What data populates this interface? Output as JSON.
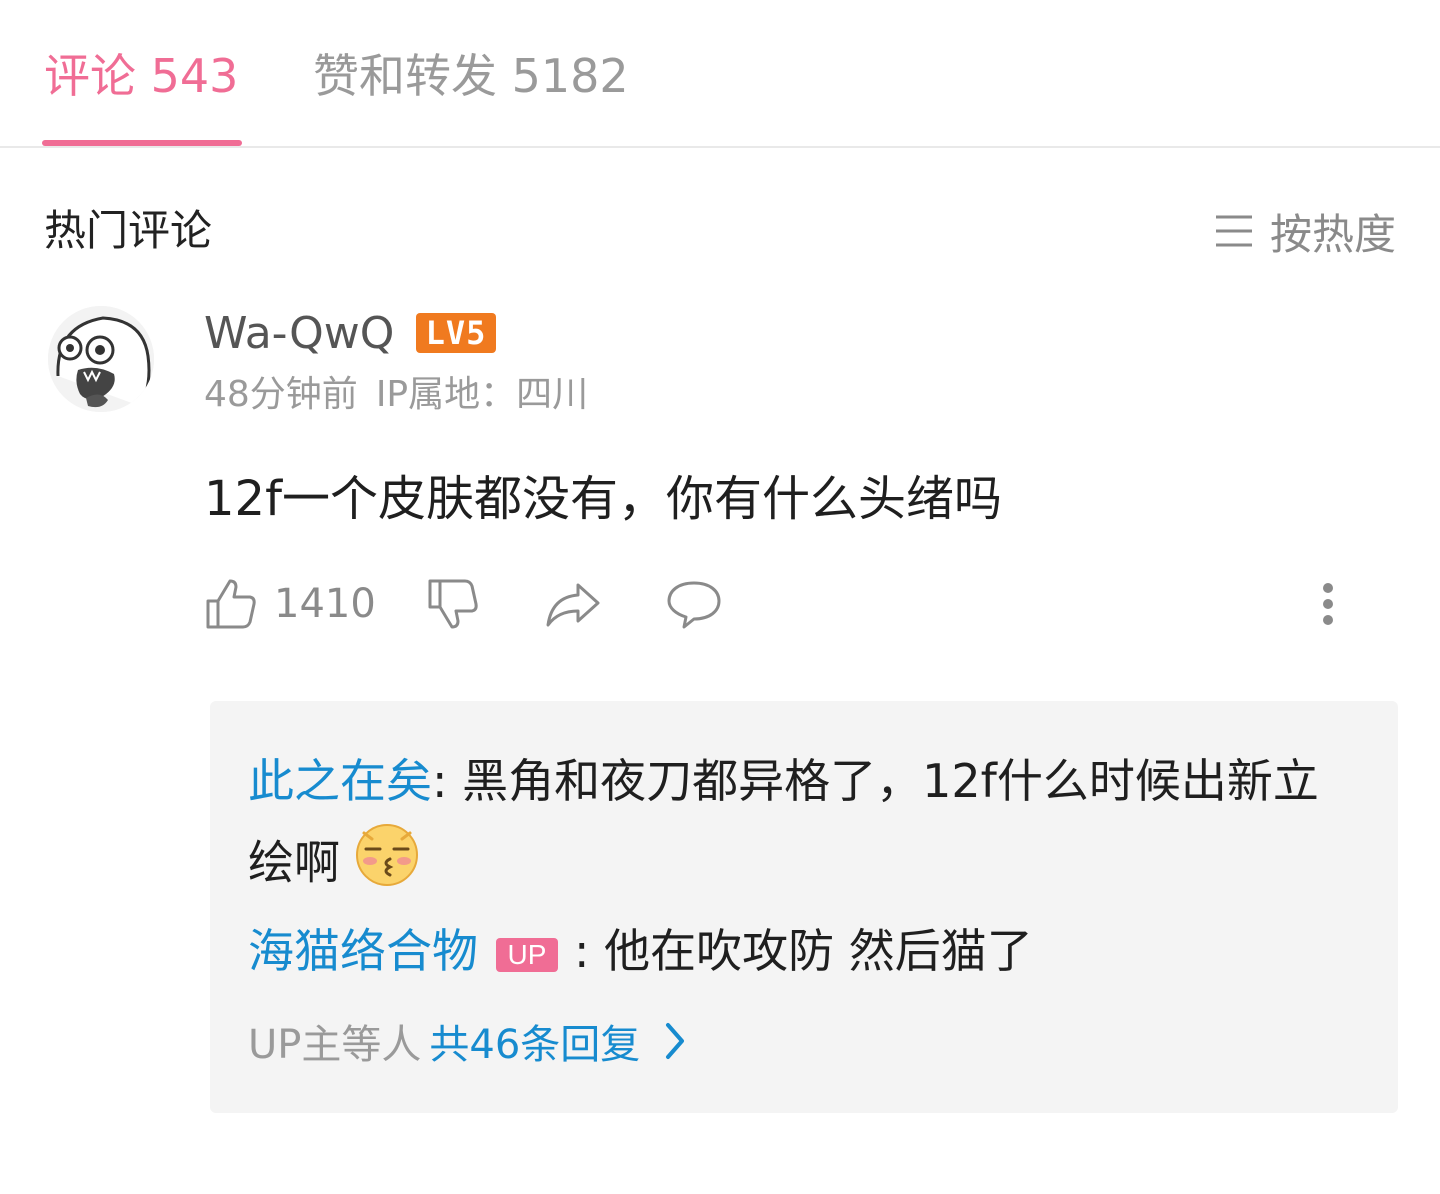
{
  "tabs": {
    "comments_label": "评论 543",
    "likes_label": "赞和转发 5182"
  },
  "section": {
    "title": "热门评论",
    "sort_label": "按热度"
  },
  "comment": {
    "username": "Wa-QwQ",
    "level_badge": "LV5",
    "time": "48分钟前",
    "ip_location": "IP属地：四川",
    "content": "12f一个皮肤都没有，你有什么头绪吗",
    "like_count": "1410"
  },
  "replies": [
    {
      "author": "此之在矣",
      "separator": ":",
      "text": " 黑角和夜刀都异格了，12f什么时候出新立绘啊"
    },
    {
      "author": "海猫络合物",
      "badge": "UP",
      "separator": ":",
      "text": " 他在吹攻防 然后猫了"
    }
  ],
  "more_replies": {
    "prefix": "UP主等人",
    "link": "共46条回复"
  },
  "colors": {
    "accent_pink": "#f06d95",
    "link_blue": "#178bcf",
    "level_orange": "#f07a1f"
  },
  "icons": [
    "sort-list-icon",
    "thumbs-up-icon",
    "thumbs-down-icon",
    "share-icon",
    "comment-bubble-icon",
    "more-vertical-icon",
    "kiss-face-emoji",
    "chevron-right-icon"
  ]
}
